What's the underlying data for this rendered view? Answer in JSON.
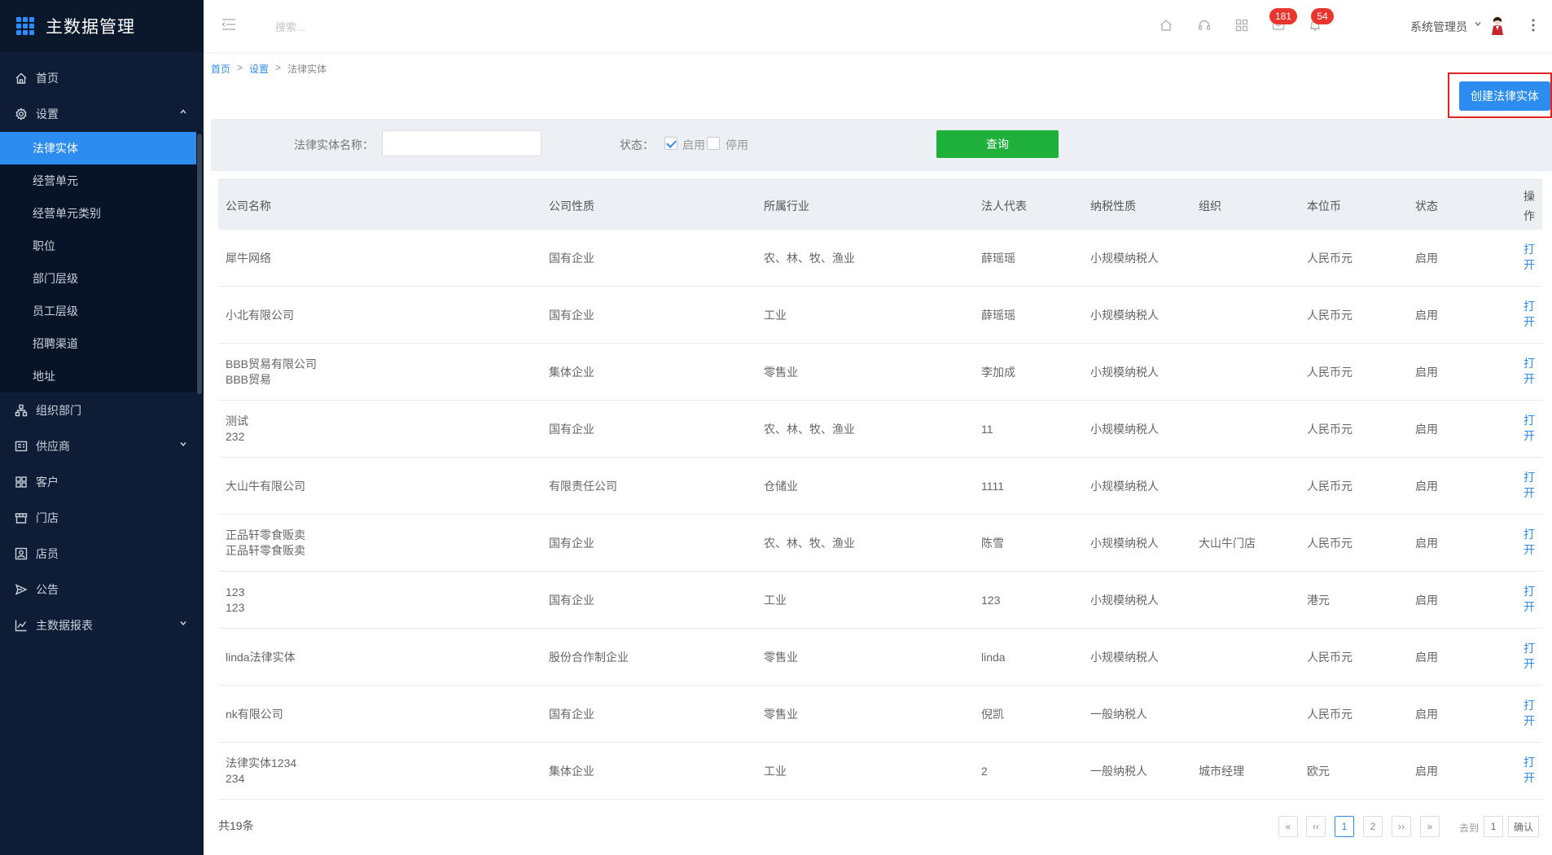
{
  "app": {
    "title": "主数据管理"
  },
  "menu": {
    "home": "首页",
    "settings": "设置",
    "settings_sub": [
      "法律实体",
      "经营单元",
      "经营单元类别",
      "职位",
      "部门层级",
      "员工层级",
      "招聘渠道",
      "地址"
    ],
    "org": "组织部门",
    "supplier": "供应商",
    "customer": "客户",
    "store": "门店",
    "clerk": "店员",
    "notice": "公告",
    "report": "主数据报表"
  },
  "header": {
    "search_placeholder": "搜索...",
    "badge_messages": "181",
    "badge_notifications": "54",
    "user_name": "系统管理员"
  },
  "breadcrumb": {
    "home": "首页",
    "settings": "设置",
    "current": "法律实体",
    "sep": ">"
  },
  "create_button": "创建法律实体",
  "filter": {
    "name_label": "法律实体名称：",
    "status_label": "状态：",
    "enabled_label": "启用",
    "disabled_label": "停用",
    "enabled_checked": true,
    "disabled_checked": false,
    "query_button": "查询"
  },
  "table": {
    "headers": {
      "company": "公司名称",
      "nature": "公司性质",
      "industry": "所属行业",
      "legal_rep": "法人代表",
      "tax": "纳税性质",
      "org": "组织",
      "currency": "本位币",
      "status": "状态",
      "op1": "操",
      "op2": "作"
    },
    "op_text1": "打",
    "op_text2": "开",
    "rows": [
      {
        "company": "犀牛网络",
        "company2": "",
        "nature": "国有企业",
        "industry": "农、林、牧、渔业",
        "legal_rep": "薛瑶瑶",
        "tax": "小规模纳税人",
        "org": "",
        "currency": "人民币元",
        "status": "启用"
      },
      {
        "company": "小北有限公司",
        "company2": "",
        "nature": "国有企业",
        "industry": "工业",
        "legal_rep": "薛瑶瑶",
        "tax": "小规模纳税人",
        "org": "",
        "currency": "人民币元",
        "status": "启用"
      },
      {
        "company": "BBB贸易有限公司",
        "company2": "BBB贸易",
        "nature": "集体企业",
        "industry": "零售业",
        "legal_rep": "李加成",
        "tax": "小规模纳税人",
        "org": "",
        "currency": "人民币元",
        "status": "启用"
      },
      {
        "company": "测试",
        "company2": "232",
        "nature": "国有企业",
        "industry": "农、林、牧、渔业",
        "legal_rep": "11",
        "tax": "小规模纳税人",
        "org": "",
        "currency": "人民币元",
        "status": "启用"
      },
      {
        "company": "大山牛有限公司",
        "company2": "",
        "nature": "有限责任公司",
        "industry": "仓储业",
        "legal_rep": "1111",
        "tax": "小规模纳税人",
        "org": "",
        "currency": "人民币元",
        "status": "启用"
      },
      {
        "company": "正品轩零食贩卖",
        "company2": "正品轩零食贩卖",
        "nature": "国有企业",
        "industry": "农、林、牧、渔业",
        "legal_rep": "陈雪",
        "tax": "小规模纳税人",
        "org": "大山牛门店",
        "currency": "人民币元",
        "status": "启用"
      },
      {
        "company": "123",
        "company2": "123",
        "nature": "国有企业",
        "industry": "工业",
        "legal_rep": "123",
        "tax": "小规模纳税人",
        "org": "",
        "currency": "港元",
        "status": "启用"
      },
      {
        "company": "linda法律实体",
        "company2": "",
        "nature": "股份合作制企业",
        "industry": "零售业",
        "legal_rep": "linda",
        "tax": "小规模纳税人",
        "org": "",
        "currency": "人民币元",
        "status": "启用"
      },
      {
        "company": "nk有限公司",
        "company2": "",
        "nature": "国有企业",
        "industry": "零售业",
        "legal_rep": "倪凯",
        "tax": "一般纳税人",
        "org": "",
        "currency": "人民币元",
        "status": "启用"
      },
      {
        "company": "法律实体1234",
        "company2": "234",
        "nature": "集体企业",
        "industry": "工业",
        "legal_rep": "2",
        "tax": "一般纳税人",
        "org": "城市经理",
        "currency": "欧元",
        "status": "启用"
      }
    ]
  },
  "footer": {
    "total": "共19条",
    "pager": {
      "first": "«",
      "prev": "‹‹",
      "page1": "1",
      "page2": "2",
      "next": "››",
      "last": "»"
    },
    "goto_label": "去到",
    "goto_value": "1",
    "confirm": "确认"
  }
}
